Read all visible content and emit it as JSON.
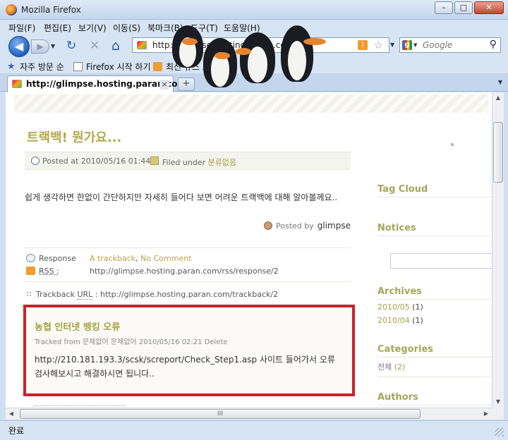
{
  "window": {
    "title": "Mozilla Firefox",
    "min": "–",
    "max": "□",
    "close": "✕"
  },
  "menu": [
    "파일(F)",
    "편집(E)",
    "보기(V)",
    "이동(S)",
    "북마크(B)",
    "도구(T)",
    "도움말(H)"
  ],
  "nav": {
    "back": "◀",
    "forward": "▶",
    "dropdown": "▼",
    "reload": "↻",
    "stop": "✕",
    "home": "⌂",
    "url": "http://glimpse.hosting.paran.com/",
    "search_placeholder": "Google"
  },
  "bookmarks": [
    "자주 방문 순",
    "Firefox 시작 하기",
    "최신 뉴스 보기"
  ],
  "tab": {
    "title": "http://glimpse.hosting.paran.com/",
    "close": "×",
    "new": "+"
  },
  "post": {
    "title": "트랙백! 뭔가요...",
    "posted": "Posted at 2010/05/16 01:44",
    "filed_label": "Filed under",
    "category": "분류없음",
    "body": "쉽게 생각하면 한없이 간단하지만 자세히 들어다 보면 어려운 트랙백에 대해 알아볼께요..",
    "posted_by_label": "Posted by",
    "author": "glimpse"
  },
  "response": {
    "label": "Response",
    "trackback_link": "A trackback",
    "comma": ",",
    "comment_link": "No Comment",
    "rss_label": "RSS :",
    "rss_url": "http://glimpse.hosting.paran.com/rss/response/2",
    "trackback_url_label": "Trackback",
    "trackback_url_abbr": "URL",
    "trackback_url": ": http://glimpse.hosting.paran.com/trackback/2"
  },
  "trackback": {
    "title": "농협 인터넷 뱅킹 오류",
    "tracked_from": "Tracked from 문제없어 문제없어 2010/05/16 02:21 Delete",
    "body": "http://210.181.193.3/scsk/screport/Check_Step1.asp 사이트 들어가서 오류 검사해보시고 해결하시면 됩니다.."
  },
  "sidebar": {
    "tag_cloud": "Tag Cloud",
    "notices": "Notices",
    "archives": "Archives",
    "archive_items": [
      {
        "label": "2010/05",
        "count": "(1)"
      },
      {
        "label": "2010/04",
        "count": "(1)"
      }
    ],
    "categories": "Categories",
    "category_item": {
      "label": "전체",
      "count": "(2)"
    },
    "authors": "Authors"
  },
  "status": "완료",
  "scroll": {
    "up": "▲",
    "down": "▼",
    "left": "◀",
    "right": "▶",
    "grip": "III"
  }
}
